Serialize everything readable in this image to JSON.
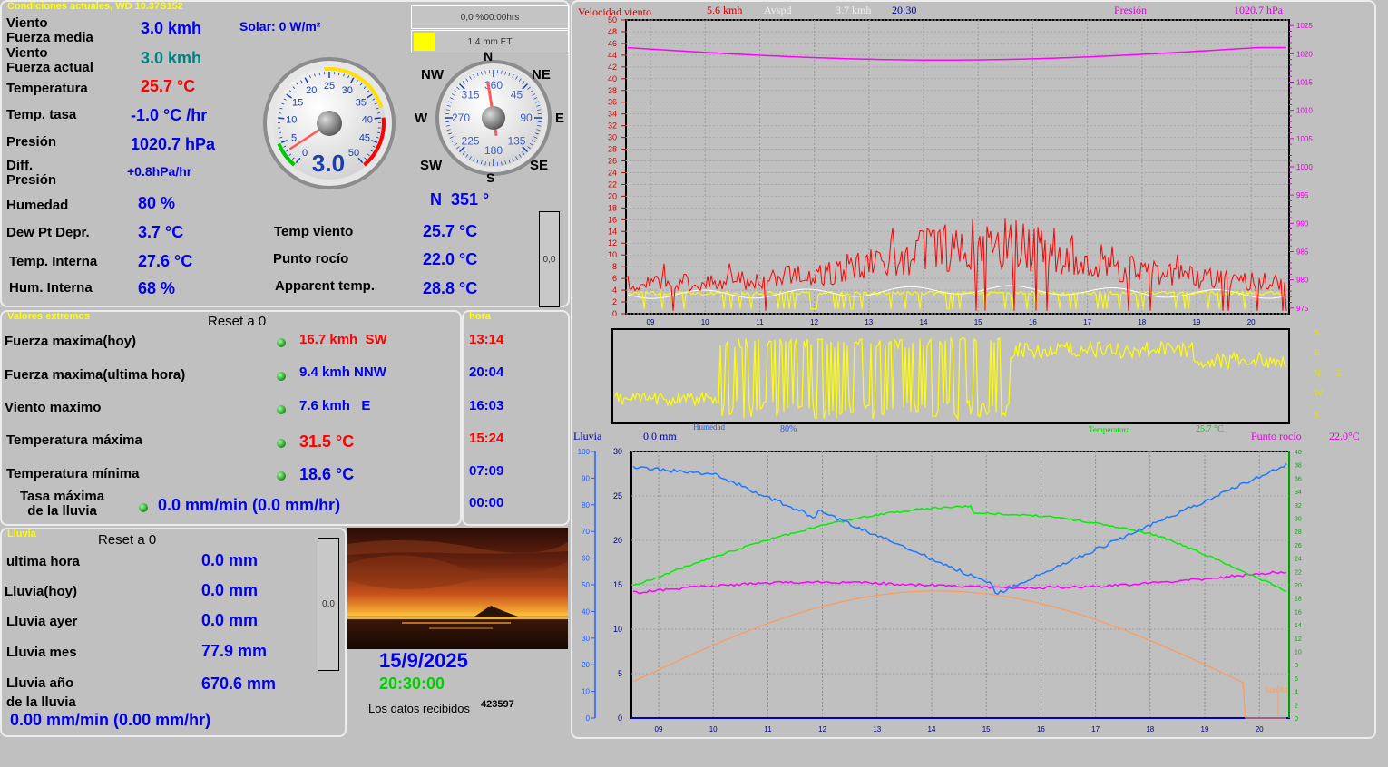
{
  "current": {
    "title": "Condiciones actuales, WD 10.37S152",
    "wind_avg_label": "Viento\nFuerza media",
    "wind_avg_value": "3.0 kmh",
    "wind_cur_label": "Viento\nFuerza actual",
    "wind_cur_value": "3.0 kmh",
    "temp_label": "Temperatura",
    "temp_value": "25.7 °C",
    "temp_rate_label": "Temp. tasa",
    "temp_rate_value": "-1.0 °C /hr",
    "pressure_label": "Presión",
    "pressure_value": "1020.7 hPa",
    "pressure_diff_label": "Diff.\nPresión",
    "pressure_diff_value": "+0.8hPa/hr",
    "humidity_label": "Humedad",
    "humidity_value": "80 %",
    "dewdepr_label": "Dew Pt Depr.",
    "dewdepr_value": "3.7 °C",
    "intemp_label": "Temp. Interna",
    "intemp_value": "27.6 °C",
    "inhum_label": "Hum. Interna",
    "inhum_value": "68 %",
    "solar_value": "Solar: 0 W/m²",
    "windchill_label": "Temp viento",
    "windchill_value": "25.7 °C",
    "dew_label": "Punto rocío",
    "dew_value": "22.0 °C",
    "apparent_label": "Apparent temp.",
    "apparent_value": "28.8 °C",
    "et_hours": "0,0 %00:00hrs",
    "et_value": "1,4 mm ET",
    "bar_value": "0,0",
    "speed_gauge": {
      "value": "3.0",
      "ticks": [
        "0",
        "5",
        "10",
        "15",
        "20",
        "25",
        "30",
        "35",
        "40",
        "45",
        "50"
      ]
    },
    "compass": {
      "labels": {
        "n": "N",
        "ne": "NE",
        "e": "E",
        "se": "SE",
        "s": "S",
        "sw": "SW",
        "w": "W",
        "nw": "NW"
      },
      "ticks": [
        "360",
        "45",
        "90",
        "135",
        "180",
        "225",
        "270",
        "315"
      ],
      "dir_text": "N  351 °"
    }
  },
  "extremes": {
    "title": "Valores extremos",
    "reset": "Reset a 0",
    "hora_title": "hora",
    "rows": [
      {
        "label": "Fuerza maxima(hoy)",
        "value": "16.7 kmh  SW",
        "time": "13:14"
      },
      {
        "label": "Fuerza maxima(ultima hora)",
        "value": "9.4 kmh NNW",
        "time": "20:04"
      },
      {
        "label": "Viento maximo",
        "value": "7.6 kmh   E",
        "time": "16:03"
      },
      {
        "label": "Temperatura máxima",
        "value": "31.5 °C",
        "time": "15:24"
      },
      {
        "label": "Temperatura mínima",
        "value": "18.6 °C",
        "time": "07:09"
      },
      {
        "label": "Tasa máxima\nde la lluvia",
        "value": "0.0 mm/min (0.0 mm/hr)",
        "time": "00:00"
      }
    ]
  },
  "rain": {
    "title": "Lluvia",
    "reset": "Reset a 0",
    "lasthour_label": "ultima hora",
    "lasthour_value": "0.0 mm",
    "today_label": "Lluvia(hoy)",
    "today_value": "0.0 mm",
    "yesterday_label": "Lluvia ayer",
    "yesterday_value": "0.0 mm",
    "month_label": "Lluvia mes",
    "month_value": "77.9 mm",
    "year_label": "Lluvia año\nde la lluvia",
    "year_value": "670.6 mm",
    "rate_value": "0.00 mm/min (0.00 mm/hr)",
    "bar_value": "0,0"
  },
  "status": {
    "date": "15/9/2025",
    "time": "20:30:00",
    "received_label": "Los datos recibidos",
    "received_count": "423597"
  },
  "wind_chart": {
    "title": "Velocidad viento",
    "speed": "5.6 kmh",
    "avspd_label": "Avspd",
    "avspd": "3.7 kmh",
    "time": "20:30",
    "pressure_label": "Presión",
    "pressure": "1020.7 hPa",
    "y_left": [
      "0",
      "2",
      "4",
      "6",
      "8",
      "10",
      "12",
      "14",
      "16",
      "18",
      "20",
      "22",
      "24",
      "26",
      "28",
      "30",
      "32",
      "34",
      "36",
      "38",
      "40",
      "42",
      "44",
      "46",
      "48",
      "50"
    ],
    "y_right": [
      "975",
      "980",
      "985",
      "990",
      "995",
      "1000",
      "1005",
      "1010",
      "1015",
      "1020",
      "1025"
    ],
    "x": [
      "09",
      "10",
      "11",
      "12",
      "13",
      "14",
      "15",
      "16",
      "17",
      "18",
      "19",
      "20"
    ],
    "dir_labels": [
      "S",
      "E",
      "N",
      "W",
      "S"
    ],
    "dir_mark": "2"
  },
  "temp_chart": {
    "rain_label": "Lluvia",
    "rain_value": "0.0 mm",
    "hum_label": "Humedad",
    "hum_value": "80%",
    "temp_label": "Temperatura",
    "temp_value": "25.7 °C",
    "dew_label": "Punto rocío",
    "dew_value": "22.0°C",
    "y_hum": [
      "0",
      "10",
      "20",
      "30",
      "40",
      "50",
      "60",
      "70",
      "80",
      "90",
      "100"
    ],
    "y_rain": [
      "0",
      "5",
      "10",
      "15",
      "20",
      "25",
      "30"
    ],
    "y_temp": [
      "0",
      "2",
      "4",
      "6",
      "8",
      "10",
      "12",
      "14",
      "16",
      "18",
      "20",
      "22",
      "24",
      "26",
      "28",
      "30",
      "32",
      "34",
      "36",
      "38",
      "40"
    ],
    "x": [
      "09",
      "10",
      "11",
      "12",
      "13",
      "14",
      "15",
      "16",
      "17",
      "18",
      "19",
      "20"
    ],
    "corner_label": "Sun Alt"
  },
  "colors": {
    "panel_bg": "#c0c0c0",
    "title": "#ffff00",
    "blue": "#0000ee",
    "red": "#ff0000",
    "green": "#00d000",
    "magenta": "#ff00ff"
  }
}
